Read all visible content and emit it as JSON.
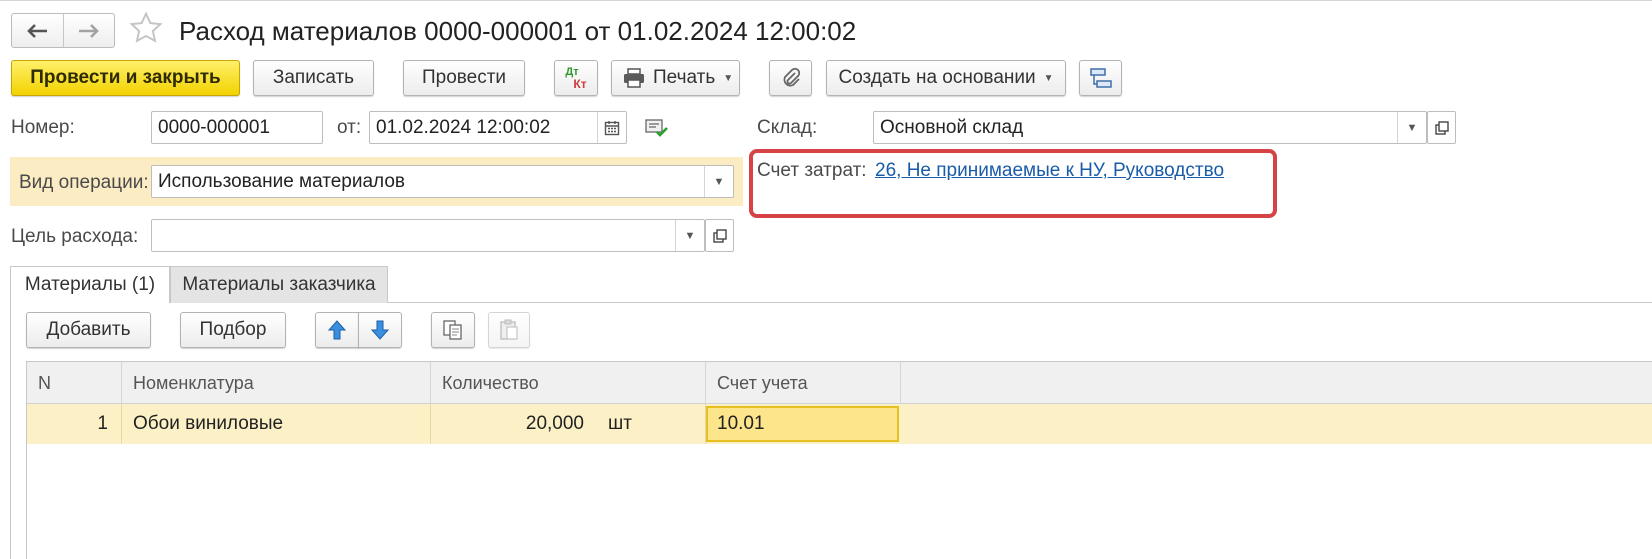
{
  "window": {
    "title": "Расход материалов 0000-000001 от 01.02.2024 12:00:02",
    "nav_back_icon": "arrow-left-icon",
    "nav_forward_icon": "arrow-right-icon",
    "favorite_icon": "star-icon"
  },
  "toolbar": {
    "post_close_label": "Провести и закрыть",
    "save_label": "Записать",
    "post_label": "Провести",
    "dtkt_top": "Дт",
    "dtkt_bottom": "Кт",
    "print_label": "Печать",
    "create_based_label": "Создать на основании",
    "primary_color": "#f5d800"
  },
  "form": {
    "number_label": "Номер:",
    "number_value": "0000-000001",
    "date_label": "от:",
    "date_value": "01.02.2024 12:00:02",
    "warehouse_label": "Склад:",
    "warehouse_value": "Основной склад",
    "operation_label": "Вид операции:",
    "operation_value": "Использование материалов",
    "expense_account_label": "Счет затрат:",
    "expense_account_value": "26, Не принимаемые к НУ, Руководство",
    "purpose_label": "Цель расхода:",
    "purpose_value": "",
    "highlight_color": "#fcecc4",
    "callout_color": "#d64245"
  },
  "tabs": [
    {
      "label": "Материалы (1)",
      "active": true
    },
    {
      "label": "Материалы заказчика",
      "active": false
    }
  ],
  "table_toolbar": {
    "add_label": "Добавить",
    "pick_label": "Подбор"
  },
  "table": {
    "columns": [
      "N",
      "Номенклатура",
      "Количество",
      "Счет учета"
    ],
    "rows": [
      {
        "n": "1",
        "item": "Обои виниловые",
        "quantity": "20,000",
        "unit": "шт",
        "account": "10.01"
      }
    ]
  }
}
